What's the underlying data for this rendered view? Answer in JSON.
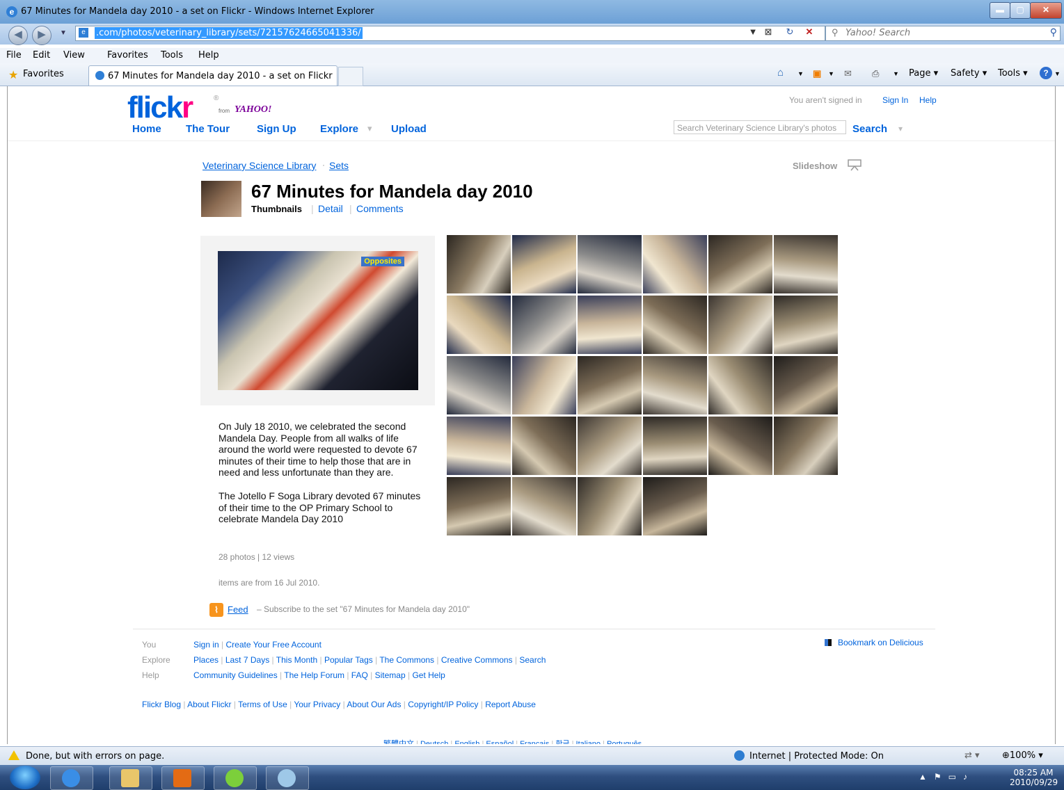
{
  "window": {
    "title": "67 Minutes for Mandela day 2010 - a set on Flickr - Windows Internet Explorer",
    "url": ".com/photos/veterinary_library/sets/72157624665041336/",
    "search_placeholder": "Yahoo! Search",
    "menu": [
      "File",
      "Edit",
      "View",
      "Favorites",
      "Tools",
      "Help"
    ],
    "favorites_label": "Favorites",
    "tab_title": "67 Minutes for Mandela day 2010 - a set on Flickr",
    "commands": {
      "page": "Page ▾",
      "safety": "Safety ▾",
      "tools": "Tools ▾"
    }
  },
  "header": {
    "logo_flick": "flick",
    "logo_r": "r",
    "logo_from": "from",
    "logo_yahoo": "YAHOO!",
    "nav": [
      "Home",
      "The Tour",
      "Sign Up",
      "Explore",
      "Upload"
    ],
    "signed_status": "You aren't signed in",
    "sign_in": "Sign In",
    "help": "Help",
    "search_placeholder": "Search Veterinary Science Library's photos",
    "search_button": "Search"
  },
  "breadcrumb": {
    "owner": "Veterinary Science Library",
    "sep": "·",
    "sets": "Sets"
  },
  "slideshow_label": "Slideshow",
  "set": {
    "title": "67 Minutes for Mandela day 2010",
    "tabs": [
      "Thumbnails",
      "Detail",
      "Comments"
    ],
    "hero_label": "Opposites",
    "description": [
      "On July 18 2010, we celebrated the second Mandela Day. People from all walks of life around the world were requested to devote 67 minutes of their time to help those that are in need and less unfortunate than they are.",
      "The Jotello F Soga Library devoted 67 minutes of their time to the OP Primary School to celebrate Mandela Day 2010"
    ],
    "stats": "28 photos | 12 views",
    "date_note": "items are from 16 Jul 2010.",
    "feed_link": "Feed",
    "feed_text": "– Subscribe to the set \"67 Minutes for Mandela day 2010\"",
    "photo_count": 28
  },
  "footer": {
    "you_label": "You",
    "explore_label": "Explore",
    "help_label": "Help",
    "you_links": [
      "Sign in",
      "Create Your Free Account"
    ],
    "explore_links": [
      "Places",
      "Last 7 Days",
      "This Month",
      "Popular Tags",
      "The Commons",
      "Creative Commons",
      "Search"
    ],
    "help_links": [
      "Community Guidelines",
      "The Help Forum",
      "FAQ",
      "Sitemap",
      "Get Help"
    ],
    "bottom_links": [
      "Flickr Blog",
      "About Flickr",
      "Terms of Use",
      "Your Privacy",
      "About Our Ads",
      "Copyright/IP Policy",
      "Report Abuse"
    ],
    "languages": [
      "繁體中文",
      "Deutsch",
      "English",
      "Español",
      "Français",
      "한글",
      "Italiano",
      "Português"
    ],
    "delicious": "Bookmark on Delicious"
  },
  "status": {
    "text": "Done, but with errors on page.",
    "zone": "Internet | Protected Mode: On",
    "zoom": "100%"
  },
  "taskbar": {
    "time": "08:25 AM",
    "date": "2010/09/29"
  }
}
